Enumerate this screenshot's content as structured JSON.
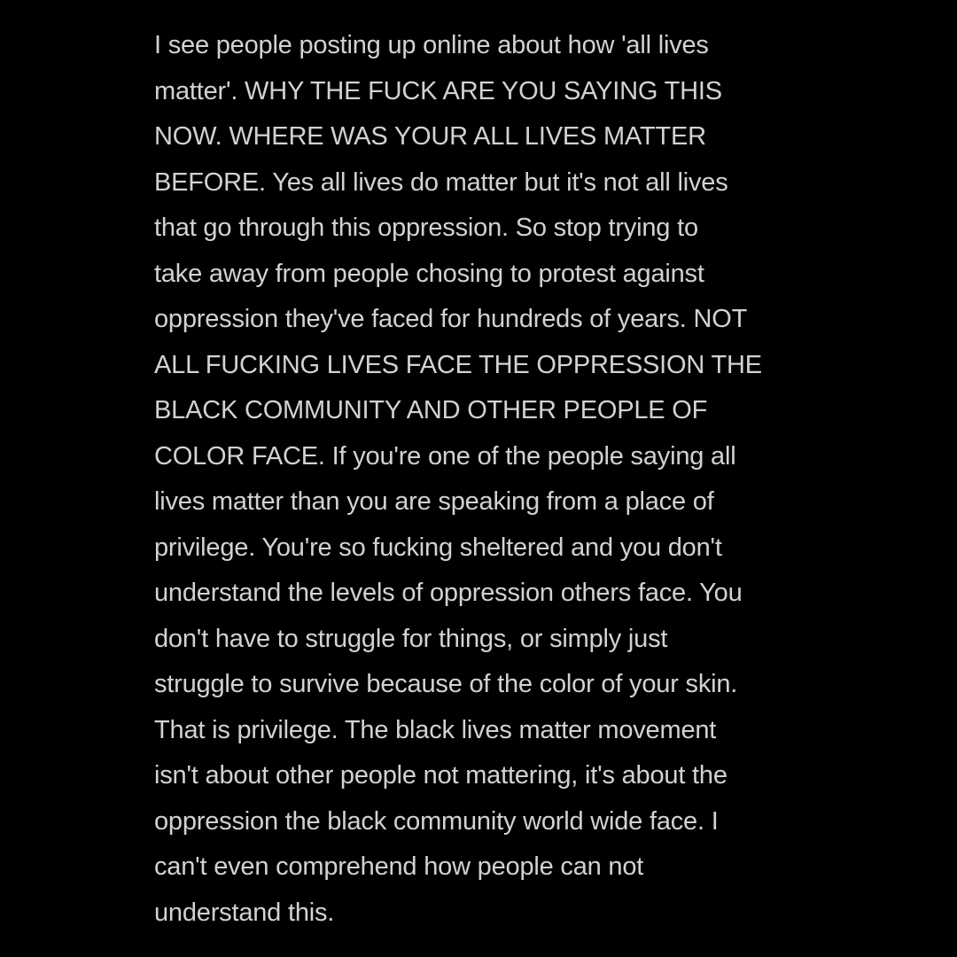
{
  "post": {
    "lines": [
      "I see people posting up online about how 'all lives",
      "matter'. WHY THE FUCK ARE YOU SAYING THIS",
      "NOW. WHERE WAS YOUR ALL LIVES MATTER",
      "BEFORE. Yes all lives do matter but it's not all lives",
      "that go through this oppression. So stop trying to",
      "take away from people chosing to protest against",
      "oppression they've faced for hundreds of years. NOT",
      "ALL FUCKING LIVES FACE THE OPPRESSION THE",
      "BLACK COMMUNITY AND OTHER PEOPLE OF",
      "COLOR FACE. If you're one of the people saying all",
      "lives matter than you are speaking from a place of",
      "privilege. You're so fucking sheltered and you don't",
      "understand the levels of oppression others face. You",
      "don't have to struggle for things, or simply just",
      "struggle to survive because of the color of your skin.",
      "That is privilege. The black lives matter movement",
      "isn't about other people not mattering, it's about the",
      "oppression the black community world wide face. I",
      "can't even comprehend how people can not",
      "understand this."
    ],
    "background_color": "#000000",
    "text_color": "#d2d2d2"
  }
}
